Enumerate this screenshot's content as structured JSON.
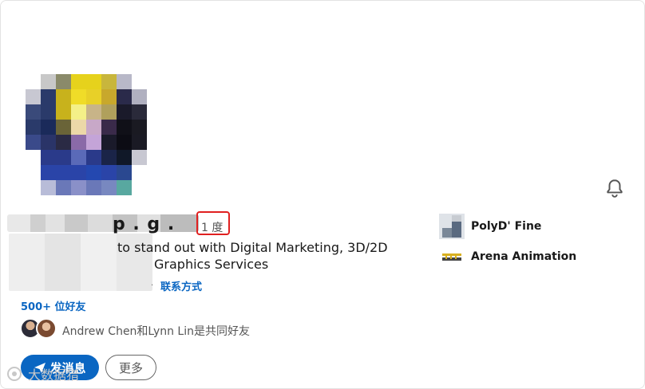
{
  "profile": {
    "degree": "1 度",
    "headline_line1": "to stand out with Digital Marketing, 3D/2D",
    "headline_line2": "Graphics Services",
    "contact_info_label": "联系方式",
    "connections_label": "500+ 位好友",
    "mutual_connections": "Andrew Chen和Lynn Lin是共同好友",
    "name_visible_fragment": "p . g ."
  },
  "actions": {
    "message_button": "发消息",
    "more_button": "更多"
  },
  "companies": [
    {
      "name": "PolyD' Fine",
      "icon": "company-logo-icon"
    },
    {
      "name": "Arena Animation",
      "icon": "company-logo-icon"
    }
  ],
  "icons": {
    "notification": "bell-icon",
    "send": "paper-plane-icon"
  },
  "watermark": {
    "text": "大数据猎"
  },
  "colors": {
    "accent": "#0a66c2",
    "highlight_box": "#e02020"
  }
}
